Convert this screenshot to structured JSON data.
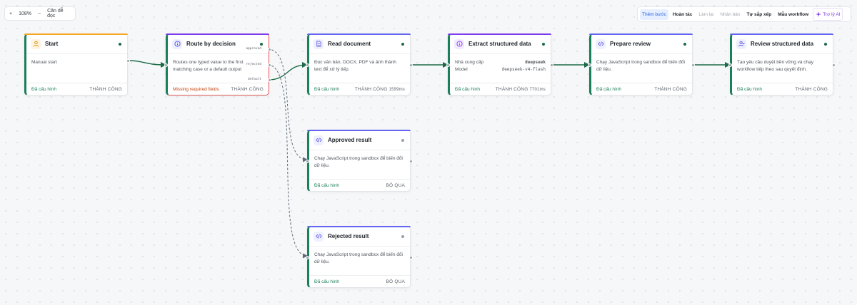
{
  "zoom": {
    "minus": "+",
    "level": "108%",
    "plus": "−",
    "fit": "Căn dễ đọc"
  },
  "toolbar": {
    "add_step": "Thêm bước",
    "undo": "Hoàn tác",
    "redo": "Làm lại",
    "duplicate": "Nhân bản",
    "arrange": "Tự sắp xếp",
    "templates": "Mẫu workflow",
    "ai": "Trợ lý AI"
  },
  "colors": {
    "accent_green": "#1b7f5a",
    "accent_purple": "#7c3aed",
    "error_red": "#e05a5a",
    "warn_orange": "#c2410c"
  },
  "nodes": {
    "start": {
      "title": "Start",
      "icon": "user-icon",
      "body": "Manual start",
      "cfg": "Đã cấu hình",
      "result": "THÀNH CÔNG"
    },
    "route": {
      "title": "Route by decision",
      "icon": "info-icon",
      "body": "Routes one typed value to the first matching case or a default output",
      "cfg": "Missing required fields",
      "result": "THÀNH CÔNG",
      "handles": {
        "approved": "approved",
        "rejected": "rejected",
        "default": "default"
      }
    },
    "read": {
      "title": "Read document",
      "icon": "document-icon",
      "body": "Đọc văn bản, DOCX, PDF và ảnh thành text để xử lý tiếp.",
      "cfg": "Đã cấu hình",
      "result": "THÀNH CÔNG",
      "ms": "1599ms"
    },
    "extract": {
      "title": "Extract structured data",
      "icon": "info-icon",
      "provider_label": "Nhà cung cấp",
      "provider": "deepseek",
      "model_label": "Model",
      "model": "deepseek-v4-flash",
      "cfg": "Đã cấu hình",
      "result": "THÀNH CÔNG",
      "ms": "7701ms"
    },
    "prepare": {
      "title": "Prepare review",
      "icon": "code-icon",
      "body": "Chạy JavaScript trong sandbox để biến đổi dữ liệu.",
      "cfg": "Đã cấu hình",
      "result": "THÀNH CÔNG"
    },
    "review": {
      "title": "Review structured data",
      "icon": "user-check-icon",
      "body": "Tạo yêu cầu duyệt bền vững và chạy workflow tiếp theo sau quyết định.",
      "cfg": "Đã cấu hình",
      "result": "THÀNH CÔNG"
    },
    "approved": {
      "title": "Approved result",
      "icon": "code-icon",
      "body": "Chạy JavaScript trong sandbox để biến đổi dữ liệu.",
      "cfg": "Đã cấu hình",
      "result": "BỎ QUA"
    },
    "rejected": {
      "title": "Rejected result",
      "icon": "code-icon",
      "body": "Chạy JavaScript trong sandbox để biến đổi dữ liệu.",
      "cfg": "Đã cấu hình",
      "result": "BỎ QUA"
    }
  }
}
